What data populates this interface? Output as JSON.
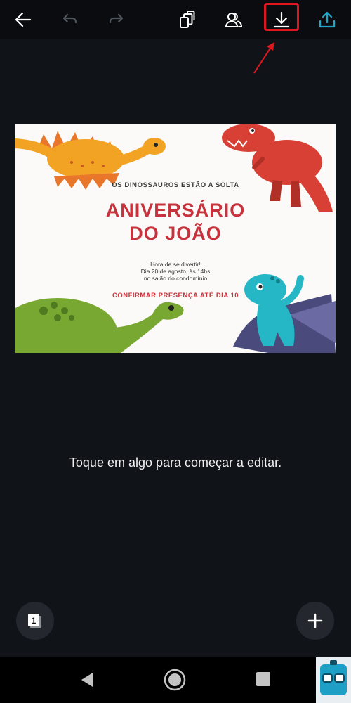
{
  "toolbar": {
    "back_icon": "arrow-left-icon",
    "undo_icon": "undo-icon",
    "redo_icon": "redo-icon",
    "copy_icon": "copy-pages-icon",
    "share_people_icon": "people-icon",
    "download_icon": "download-icon",
    "upload_icon": "share-upload-icon",
    "accent": "#1fa7c9",
    "highlight_color": "#e0171f"
  },
  "design": {
    "tagline": "OS DINOSSAUROS ESTÃO A SOLTA",
    "title_line1": "ANIVERSÁRIO",
    "title_line2": "DO JOÃO",
    "details": [
      "Hora de se divertir!",
      "Dia 20 de agosto, às 14hs",
      "no salão do condomínio"
    ],
    "rsvp": "CONFIRMAR PRESENÇA ATÉ DIA 10",
    "title_color": "#c8323c"
  },
  "hint": "Toque em algo para começar a editar.",
  "page_button": {
    "number": "1"
  },
  "navbar": {
    "back_icon": "triangle-back-icon",
    "home_icon": "circle-home-icon",
    "recent_icon": "square-recent-icon"
  }
}
